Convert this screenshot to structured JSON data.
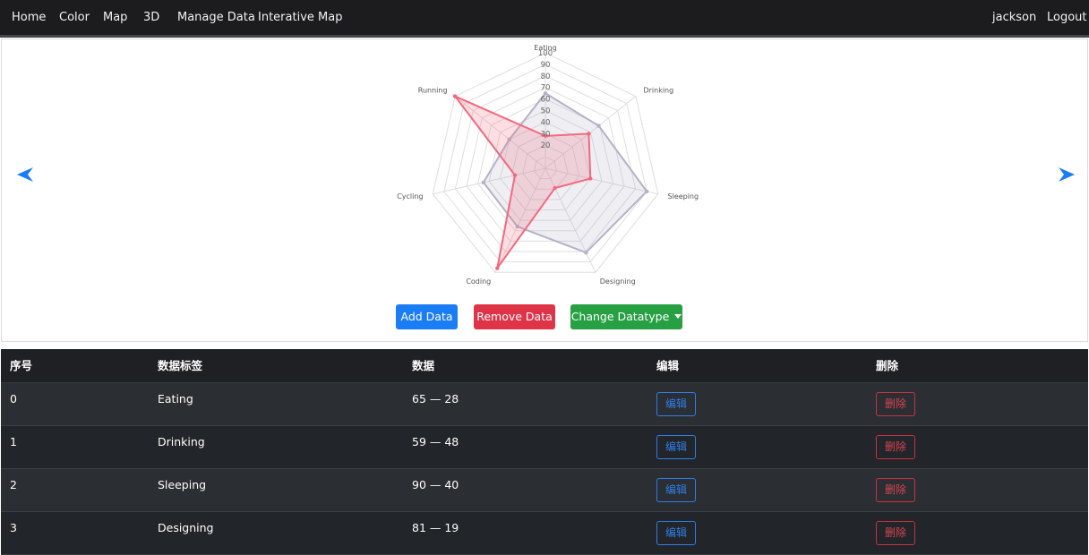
{
  "nav": {
    "left": [
      "Home",
      "Color",
      "Map",
      "3D",
      "Manage Data",
      "Interative Map"
    ],
    "user": "jackson",
    "logout": "Logout"
  },
  "chart_data": {
    "type": "radar",
    "axes": [
      "Eating",
      "Drinking",
      "Sleeping",
      "Designing",
      "Coding",
      "Cycling",
      "Running"
    ],
    "rlim": [
      0,
      100
    ],
    "ticks": [
      20,
      30,
      40,
      50,
      60,
      70,
      80,
      90,
      100
    ],
    "series": [
      {
        "values": [
          65,
          59,
          90,
          81,
          56,
          55,
          40
        ],
        "color": "#b3b2c8",
        "fill": "rgba(179,178,200,0.22)"
      },
      {
        "values": [
          28,
          48,
          40,
          19,
          96,
          27,
          100
        ],
        "color": "#f3687f",
        "fill": "rgba(243,104,127,0.22)"
      }
    ]
  },
  "buttons": {
    "add": "Add Data",
    "remove": "Remove Data",
    "change": "Change Datatype"
  },
  "table": {
    "headers": [
      "序号",
      "数据标签",
      "数据",
      "编辑",
      "删除"
    ],
    "rows": [
      {
        "index": "0",
        "label": "Eating",
        "value": "65 — 28"
      },
      {
        "index": "1",
        "label": "Drinking",
        "value": "59 — 48"
      },
      {
        "index": "2",
        "label": "Sleeping",
        "value": "90 — 40"
      },
      {
        "index": "3",
        "label": "Designing",
        "value": "81 — 19"
      }
    ],
    "edit_label": "编辑",
    "delete_label": "删除"
  },
  "colors": {
    "accent": "#1a7df6",
    "danger": "#df3448",
    "success": "#26a042",
    "navbar": "#1c1c1e"
  }
}
